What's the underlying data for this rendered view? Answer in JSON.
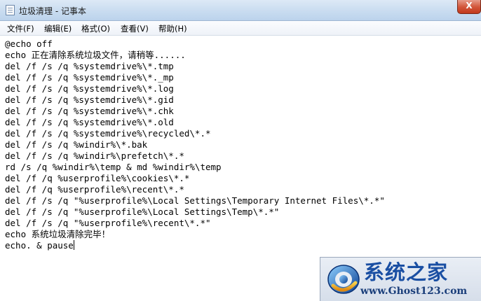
{
  "window": {
    "title": "垃圾清理 - 记事本",
    "close_label": "X"
  },
  "menu": {
    "items": [
      {
        "label": "文件(F)"
      },
      {
        "label": "编辑(E)"
      },
      {
        "label": "格式(O)"
      },
      {
        "label": "查看(V)"
      },
      {
        "label": "帮助(H)"
      }
    ]
  },
  "editor": {
    "lines": [
      "@echo off",
      "echo 正在清除系统垃圾文件，请稍等......",
      "del /f /s /q %systemdrive%\\*.tmp",
      "del /f /s /q %systemdrive%\\*._mp",
      "del /f /s /q %systemdrive%\\*.log",
      "del /f /s /q %systemdrive%\\*.gid",
      "del /f /s /q %systemdrive%\\*.chk",
      "del /f /s /q %systemdrive%\\*.old",
      "del /f /s /q %systemdrive%\\recycled\\*.*",
      "del /f /s /q %windir%\\*.bak",
      "del /f /s /q %windir%\\prefetch\\*.*",
      "rd /s /q %windir%\\temp & md %windir%\\temp",
      "del /f /q %userprofile%\\cookies\\*.*",
      "del /f /q %userprofile%\\recent\\*.*",
      "del /f /s /q \"%userprofile%\\Local Settings\\Temporary Internet Files\\*.*\"",
      "del /f /s /q \"%userprofile%\\Local Settings\\Temp\\*.*\"",
      "del /f /s /q \"%userprofile%\\recent\\*.*\"",
      "echo 系统垃圾清除完毕！",
      "echo. & pause"
    ]
  },
  "watermark": {
    "title": "系统之家",
    "url": "www.Ghost123.com",
    "accent_color": "#1a4fa3"
  }
}
